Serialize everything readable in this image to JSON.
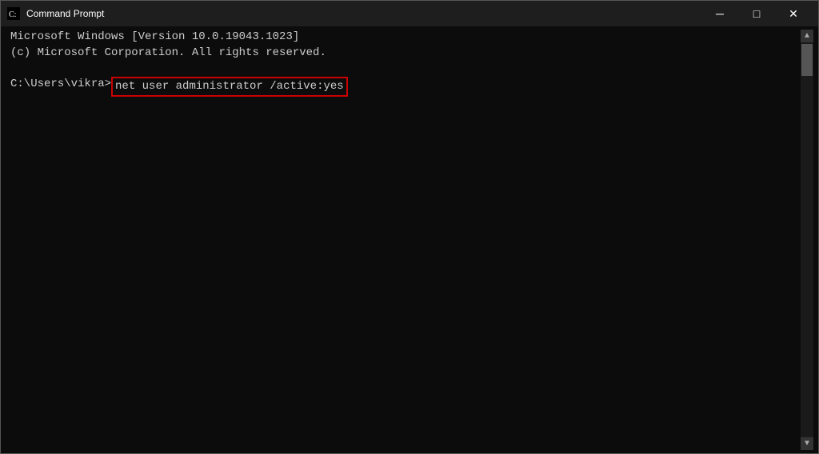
{
  "window": {
    "title": "Command Prompt",
    "icon": "cmd-icon"
  },
  "titlebar": {
    "minimize_label": "─",
    "maximize_label": "□",
    "close_label": "✕"
  },
  "console": {
    "line1": "Microsoft Windows [Version 10.0.19043.1023]",
    "line2": "(c) Microsoft Corporation. All rights reserved.",
    "line3": "",
    "prompt": "C:\\Users\\vikra>",
    "command": "net user administrator /active:yes"
  }
}
